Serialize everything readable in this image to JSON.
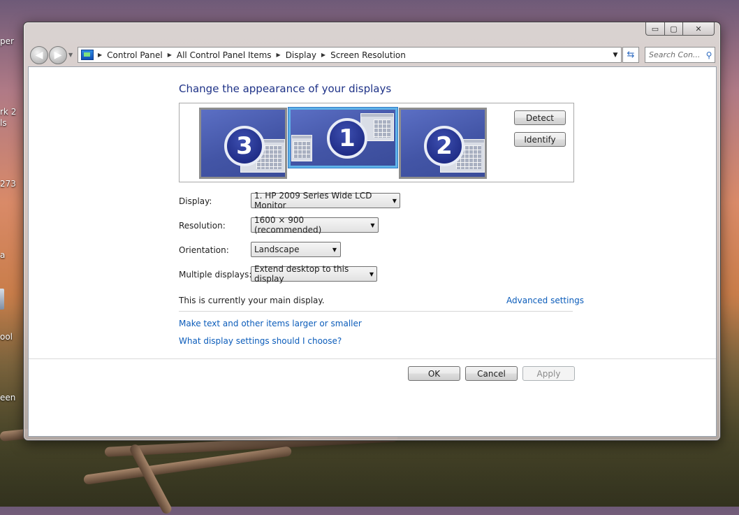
{
  "desktop": {
    "labels": [
      "per",
      "rk 2",
      "ls",
      "273",
      "a",
      "ool",
      "een"
    ]
  },
  "window": {
    "caption_buttons": {
      "minimize": "▭",
      "maximize": "▢",
      "close": "✕"
    }
  },
  "nav": {
    "breadcrumbs": [
      "Control Panel",
      "All Control Panel Items",
      "Display",
      "Screen Resolution"
    ],
    "search_placeholder": "Search Con..."
  },
  "main": {
    "title": "Change the appearance of your displays",
    "monitors": [
      {
        "number": "3",
        "selected": false
      },
      {
        "number": "1",
        "selected": true
      },
      {
        "number": "2",
        "selected": false
      }
    ],
    "detect_label": "Detect",
    "identify_label": "Identify",
    "fields": {
      "display": {
        "label": "Display:",
        "value": "1. HP 2009 Series Wide LCD Monitor"
      },
      "resolution": {
        "label": "Resolution:",
        "value": "1600 × 900 (recommended)"
      },
      "orientation": {
        "label": "Orientation:",
        "value": "Landscape"
      },
      "multiple": {
        "label": "Multiple displays:",
        "value": "Extend desktop to this display"
      }
    },
    "main_display_text": "This is currently your main display.",
    "advanced_link": "Advanced settings",
    "links": [
      "Make text and other items larger or smaller",
      "What display settings should I choose?"
    ]
  },
  "buttons": {
    "ok": "OK",
    "cancel": "Cancel",
    "apply": "Apply"
  },
  "colors": {
    "title_blue": "#1e3287",
    "link_blue": "#0b5cba",
    "monitor_blue": "#4355a6",
    "selection": "#5fb2e8"
  }
}
